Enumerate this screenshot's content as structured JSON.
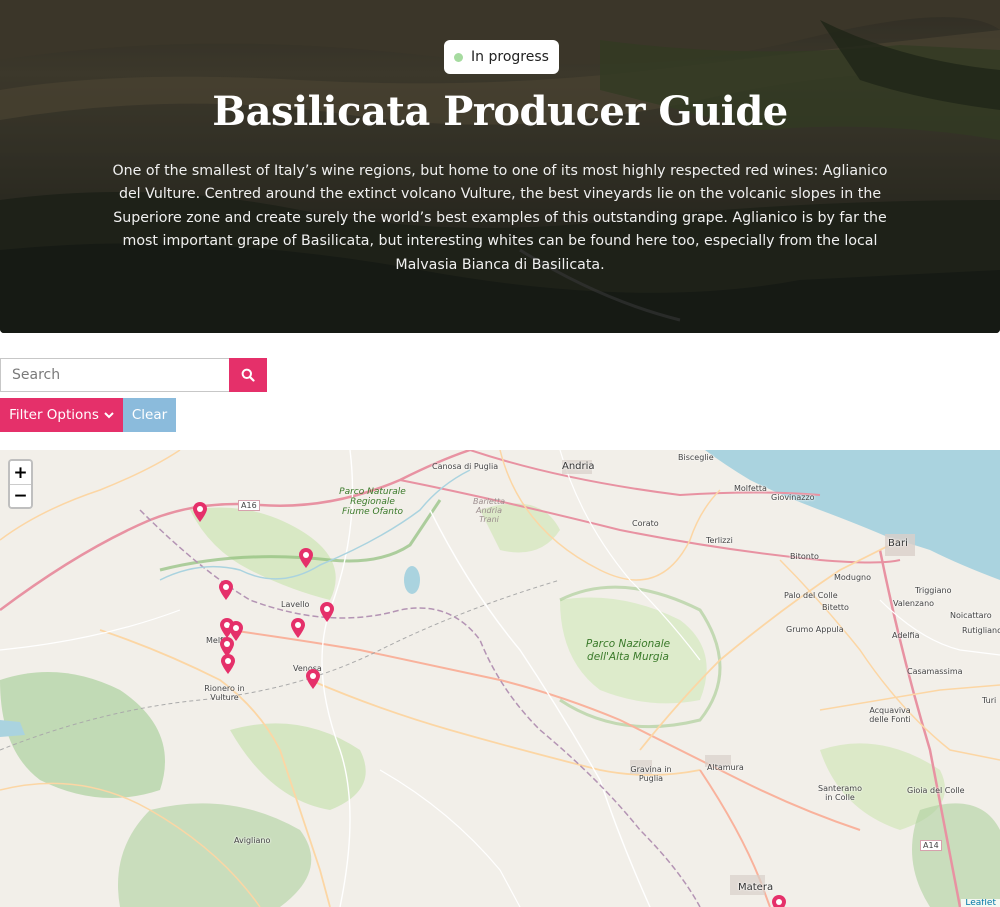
{
  "hero": {
    "status": "In progress",
    "title": "Basilicata Producer Guide",
    "description": "One of the smallest of Italy’s wine regions, but home to one of its most highly respected red wines: Aglianico del Vulture. Centred around the extinct volcano Vulture, the best vineyards lie on the volcanic slopes in the Superiore zone and create surely the world’s best examples of this outstanding grape. Aglianico is by far the most important grape of Basilicata, but interesting whites can be found here too, especially from the local Malvasia Bianca di Basilicata."
  },
  "search": {
    "placeholder": "Search",
    "icon": "search-icon"
  },
  "filters": {
    "options_label": "Filter Options",
    "clear_label": "Clear"
  },
  "colors": {
    "accent": "#e5306a",
    "clear": "#8bbbdc",
    "status_dot": "#a6dba0"
  },
  "map": {
    "zoom_in": "+",
    "zoom_out": "−",
    "attribution": "Leaflet",
    "places": {
      "canosa": "Canosa di Puglia",
      "andria": "Andria",
      "bisceglie": "Bisceglie",
      "molfetta": "Molfetta",
      "giovinazzo": "Giovinazzo",
      "barletta": "Barletta Andria Trani",
      "corato": "Corato",
      "terlizzi": "Terlizzi",
      "bitonto": "Bitonto",
      "bari": "Bari",
      "modugno": "Modugno",
      "triggiano": "Triggiano",
      "palo": "Palo del Colle",
      "bitetto": "Bitetto",
      "valenzano": "Valenzano",
      "noicattaro": "Noicattaro",
      "grumo": "Grumo Appula",
      "adelfia": "Adelfia",
      "rutigliano": "Rutigliano",
      "casamassima": "Casamassima",
      "turi": "Turi",
      "acquaviva": "Acquaviva delle Fonti",
      "lavello": "Lavello",
      "melfi": "Melfi",
      "venosa": "Venosa",
      "rionero": "Rionero in Vulture",
      "gravina": "Gravina in Puglia",
      "altamura": "Altamura",
      "santeramo": "Santeramo in Colle",
      "gioia": "Gioia del Colle",
      "avigliano": "Avigliano",
      "matera": "Matera",
      "a16": "A16",
      "a14": "A14"
    },
    "parks": {
      "ofanto": "Parco Naturale Regionale Fiume Ofanto",
      "murgia": "Parco Nazionale dell'Alta Murgia"
    }
  }
}
